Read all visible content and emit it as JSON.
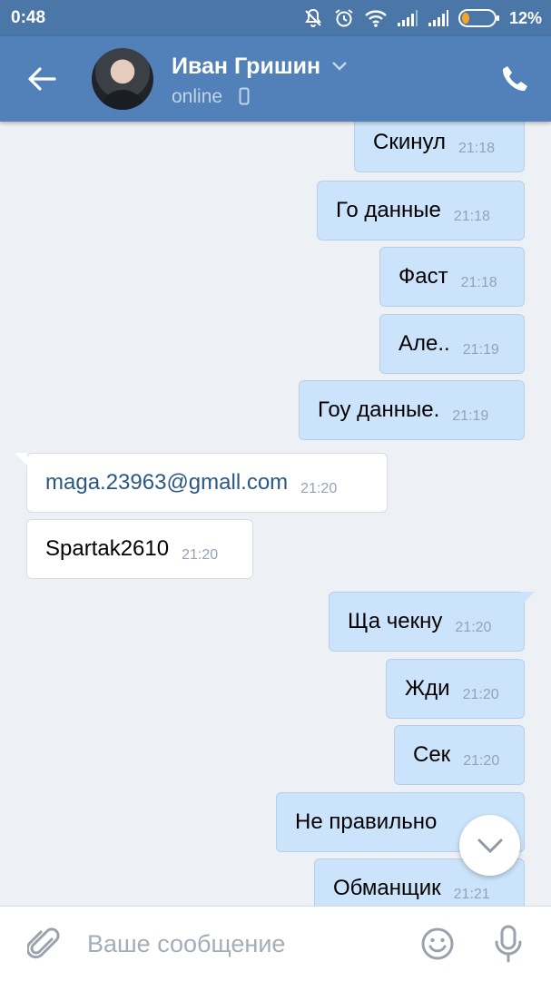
{
  "status_bar": {
    "time": "0:48",
    "battery": "12%"
  },
  "header": {
    "name": "Иван Гришин",
    "status": "online"
  },
  "messages": [
    {
      "dir": "out",
      "text": "Скинул",
      "time": "21:18"
    },
    {
      "dir": "out",
      "text": "Го данные",
      "time": "21:18"
    },
    {
      "dir": "out",
      "text": "Фаст",
      "time": "21:18"
    },
    {
      "dir": "out",
      "text": "Але..",
      "time": "21:19"
    },
    {
      "dir": "out",
      "text": "Гоу данные.",
      "time": "21:19"
    },
    {
      "dir": "in",
      "text": "maga.23963@gmall.com",
      "time": "21:20",
      "link": true
    },
    {
      "dir": "in",
      "text": "Spartak2610",
      "time": "21:20"
    },
    {
      "dir": "out",
      "text": "Ща чекну",
      "time": "21:20"
    },
    {
      "dir": "out",
      "text": "Жди",
      "time": "21:20"
    },
    {
      "dir": "out",
      "text": "Сек",
      "time": "21:20"
    },
    {
      "dir": "out",
      "text": "Не правильно",
      "time": ""
    },
    {
      "dir": "out",
      "text": "Обманщик",
      "time": "21:21"
    }
  ],
  "composer": {
    "placeholder": "Ваше сообщение"
  }
}
